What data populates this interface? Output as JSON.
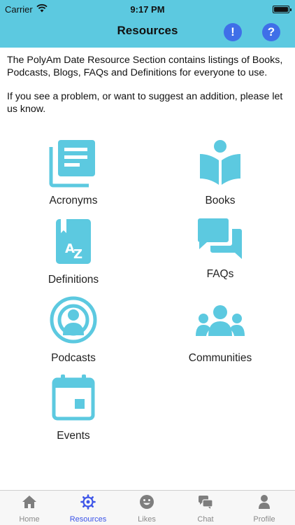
{
  "status_bar": {
    "carrier": "Carrier",
    "time": "9:17 PM"
  },
  "header": {
    "title": "Resources",
    "alert_glyph": "!",
    "help_glyph": "?",
    "background": "#5cc9e0",
    "button_color": "#3f6fe8"
  },
  "intro": {
    "paragraph1": "The PolyAm Date Resource Section contains listings of Books, Podcasts, Blogs, FAQs and Definitions for everyone to use.",
    "paragraph2": "If you see a problem, or want to suggest an addition, please let us know."
  },
  "resources": {
    "accent": "#5cc9e0",
    "items": [
      {
        "label": "Acronyms",
        "icon": "document-list-icon"
      },
      {
        "label": "Books",
        "icon": "reader-book-icon"
      },
      {
        "label": "Definitions",
        "icon": "dictionary-az-icon"
      },
      {
        "label": "FAQs",
        "icon": "chat-bubbles-icon"
      },
      {
        "label": "Podcasts",
        "icon": "podcast-icon"
      },
      {
        "label": "Communities",
        "icon": "group-icon"
      },
      {
        "label": "Events",
        "icon": "calendar-icon"
      }
    ]
  },
  "tabbar": {
    "active": "Resources",
    "active_color": "#3d55e8",
    "tabs": [
      {
        "label": "Home",
        "icon": "home-icon"
      },
      {
        "label": "Resources",
        "icon": "gear-icon"
      },
      {
        "label": "Likes",
        "icon": "smiley-icon"
      },
      {
        "label": "Chat",
        "icon": "chat-icon"
      },
      {
        "label": "Profile",
        "icon": "person-icon"
      }
    ]
  }
}
